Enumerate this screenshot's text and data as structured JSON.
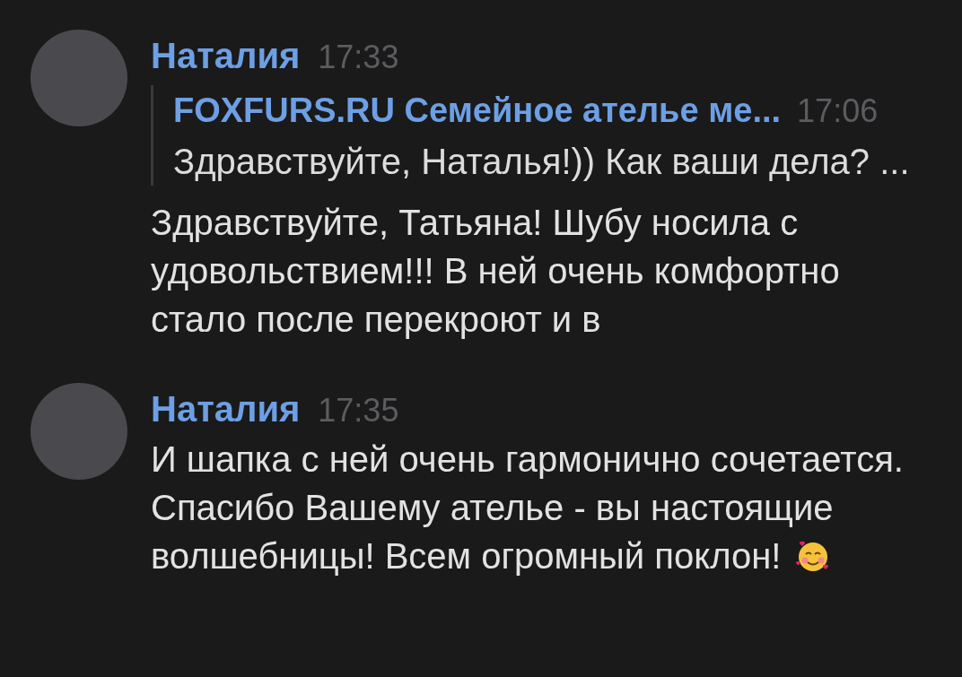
{
  "messages": [
    {
      "author": "Наталия",
      "time": "17:33",
      "reply": {
        "title": "FOXFURS.RU Семейное ателье ме...",
        "time": "17:06",
        "text": "Здравствуйте, Наталья!)) Как ваши дела? ..."
      },
      "text": "Здравствуйте, Татьяна! Шубу носила с удовольствием!!! В ней очень комфортно стало после перекроют и в",
      "emoji": false
    },
    {
      "author": "Наталия",
      "time": "17:35",
      "text": "И шапка с ней очень гармонично сочетается. Спасибо Вашему ателье - вы настоящие волшебницы! Всем огромный поклон!",
      "emoji": true
    }
  ]
}
